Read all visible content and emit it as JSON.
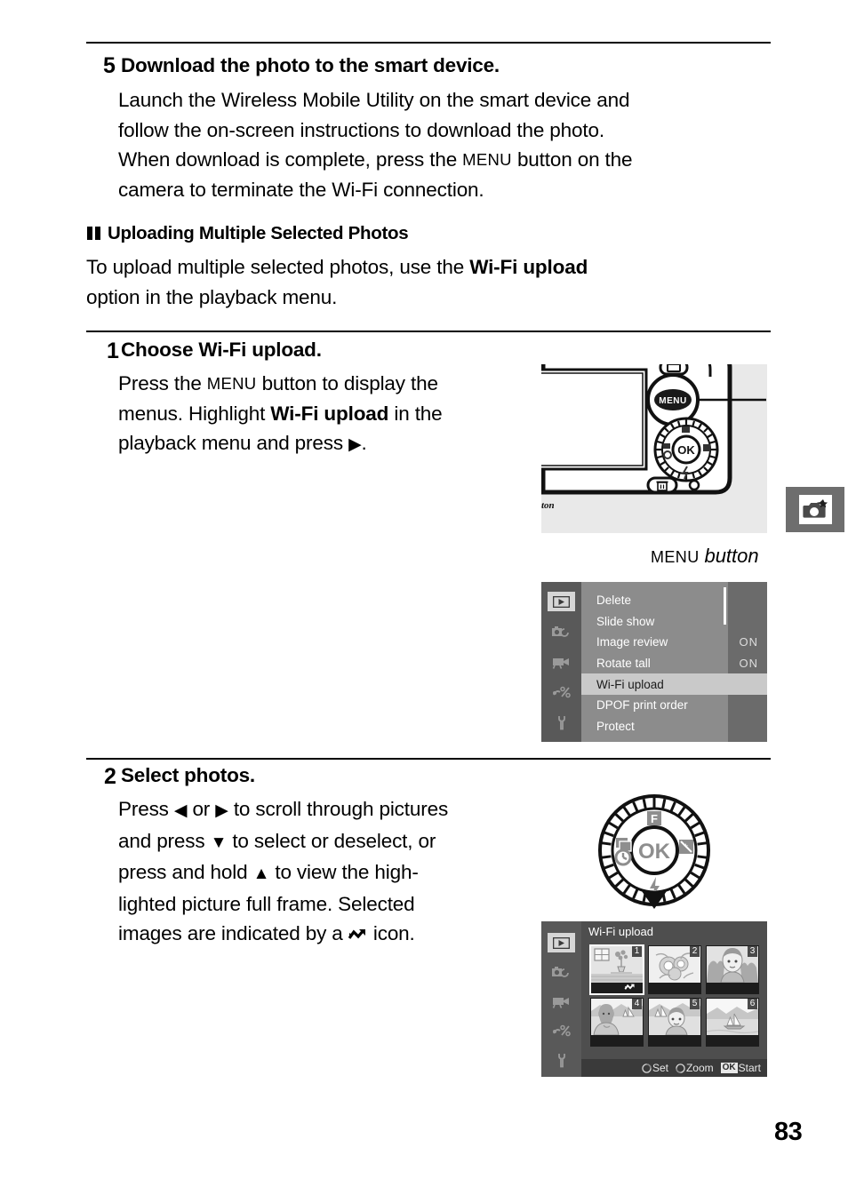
{
  "page": {
    "number": "83"
  },
  "margin_tab": {
    "icon": "camera-star-icon"
  },
  "step5": {
    "number": "5",
    "title": "Download the photo to the smart device.",
    "line1": "Launch the Wireless Mobile Utility on the smart device and",
    "line2": "follow the on-screen instructions to download the photo.",
    "line3_a": "When download is complete, press the ",
    "line3_menu": "MENU",
    "line3_b": " button on the",
    "line4": "camera to terminate the Wi-Fi connection."
  },
  "section": {
    "heading": "Uploading Multiple Selected Photos",
    "para_a": "To upload multiple selected photos, use the ",
    "para_bold": "Wi-Fi upload",
    "para_b": "option in the playback menu."
  },
  "step1": {
    "number": "1",
    "title_a": "Choose ",
    "title_bold": "Wi-Fi upload",
    "title_b": ".",
    "line1_a": "Press the ",
    "line1_menu": "MENU",
    "line1_b": " button to display the",
    "line2_a": "menus. Highlight ",
    "line2_bold": "Wi-Fi upload",
    "line2_b": " in the",
    "line3_a": "playback menu and press ",
    "line3_tri": "▶",
    "line3_b": "."
  },
  "menu_caption": {
    "menu_word": "MENU",
    "button_word": "button"
  },
  "camera_figure": {
    "menu_button_label": "MENU",
    "ok_button_label": "OK",
    "brand_text": "ton"
  },
  "menu_screen": {
    "sidebar_icons": [
      "playback-icon",
      "shooting-menu-icon",
      "movie-icon",
      "custom-settings-icon",
      "setup-wrench-icon"
    ],
    "rows": [
      {
        "label": "Delete",
        "value": ""
      },
      {
        "label": "Slide show",
        "value": ""
      },
      {
        "label": "Image review",
        "value": "ON"
      },
      {
        "label": "Rotate tall",
        "value": "ON"
      },
      {
        "label": "Wi-Fi upload",
        "value": "",
        "highlighted": true
      },
      {
        "label": "DPOF print order",
        "value": ""
      },
      {
        "label": "Protect",
        "value": ""
      }
    ]
  },
  "step2": {
    "number": "2",
    "title": "Select photos.",
    "line1_a": "Press ",
    "line1_left": "◀",
    "line1_b": " or ",
    "line1_right": "▶",
    "line1_c": " to scroll through pictures",
    "line2_a": "and press ",
    "line2_down": "▼",
    "line2_b": " to select or deselect, or",
    "line3_a": "press and hold ",
    "line3_up": "▲",
    "line3_b": " to view the high-",
    "line4": "lighted picture full frame. Selected",
    "line5_a": "images are indicated by a ",
    "line5_icon": "wifi-upload-mark-icon",
    "line5_b": " icon."
  },
  "dial": {
    "center_label": "OK",
    "top_label": "F",
    "right_label": "exposure-compensation-icon",
    "left_label": "release-mode-icon",
    "bottom_left_label": "self-timer-icon",
    "bottom_label": "flash-icon"
  },
  "thumb_screen": {
    "title": "Wi-Fi upload",
    "sidebar_icons": [
      "playback-icon",
      "shooting-menu-icon",
      "movie-icon",
      "custom-settings-icon",
      "setup-wrench-icon"
    ],
    "thumbnails": [
      {
        "index": "1",
        "subject": "flower-vase-in-room",
        "selected": true,
        "marked": true
      },
      {
        "index": "2",
        "subject": "flowers-closeup",
        "selected": false,
        "marked": false
      },
      {
        "index": "3",
        "subject": "portrait-child",
        "selected": false,
        "marked": false
      },
      {
        "index": "4",
        "subject": "woman-at-lake",
        "selected": false,
        "marked": false
      },
      {
        "index": "5",
        "subject": "boy-at-lake",
        "selected": false,
        "marked": false
      },
      {
        "index": "6",
        "subject": "sailboat-landscape",
        "selected": false,
        "marked": false
      }
    ],
    "footer": {
      "set_label": "Set",
      "zoom_label": "Zoom",
      "ok_badge": "OK",
      "start_label": "Start"
    }
  }
}
